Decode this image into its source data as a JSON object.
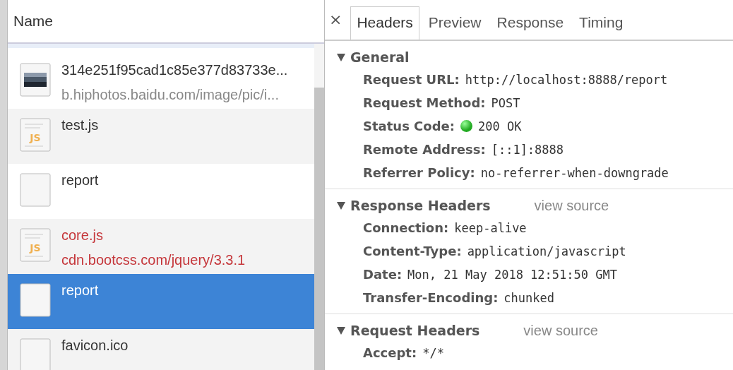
{
  "requests": {
    "column": "Name",
    "items": [
      {
        "kind": "image",
        "name": "314e251f95cad1c85e377d83733e...",
        "domain": "b.hiphotos.baidu.com/image/pic/i...",
        "error": false,
        "selected": false
      },
      {
        "kind": "script",
        "icon_text": "JS",
        "name": "test.js",
        "error": false,
        "selected": false
      },
      {
        "kind": "blank",
        "name": "report",
        "error": false,
        "selected": false
      },
      {
        "kind": "script",
        "icon_text": "JS",
        "name": "core.js",
        "domain": "cdn.bootcss.com/jquery/3.3.1",
        "error": true,
        "selected": false
      },
      {
        "kind": "blank",
        "name": "report",
        "error": false,
        "selected": true
      },
      {
        "kind": "blank",
        "name": "favicon.ico",
        "error": false,
        "selected": false
      }
    ]
  },
  "details": {
    "close": "×",
    "tabs": [
      {
        "label": "Headers",
        "selected": true
      },
      {
        "label": "Preview",
        "selected": false
      },
      {
        "label": "Response",
        "selected": false
      },
      {
        "label": "Timing",
        "selected": false
      }
    ],
    "sections": [
      {
        "title": "General",
        "expanded": true,
        "items": [
          {
            "kind": "text",
            "name": "Request URL:",
            "value": "http://localhost:8888/report"
          },
          {
            "kind": "text",
            "name": "Request Method:",
            "value": "POST"
          },
          {
            "kind": "status",
            "name": "Status Code:",
            "value": "200 OK",
            "color": "#22aa22"
          },
          {
            "kind": "text",
            "name": "Remote Address:",
            "value": "[::1]:8888"
          },
          {
            "kind": "text",
            "name": "Referrer Policy:",
            "value": "no-referrer-when-downgrade"
          }
        ]
      },
      {
        "title": "Response Headers",
        "expanded": true,
        "link": "view source",
        "items": [
          {
            "kind": "text",
            "name": "Connection:",
            "value": "keep-alive"
          },
          {
            "kind": "text",
            "name": "Content-Type:",
            "value": "application/javascript"
          },
          {
            "kind": "text",
            "name": "Date:",
            "value": "Mon, 21 May 2018 12:51:50 GMT"
          },
          {
            "kind": "text",
            "name": "Transfer-Encoding:",
            "value": "chunked"
          }
        ]
      },
      {
        "title": "Request Headers",
        "expanded": true,
        "link": "view source",
        "items": [
          {
            "kind": "text",
            "name": "Accept:",
            "value": "*/*"
          }
        ]
      }
    ]
  }
}
